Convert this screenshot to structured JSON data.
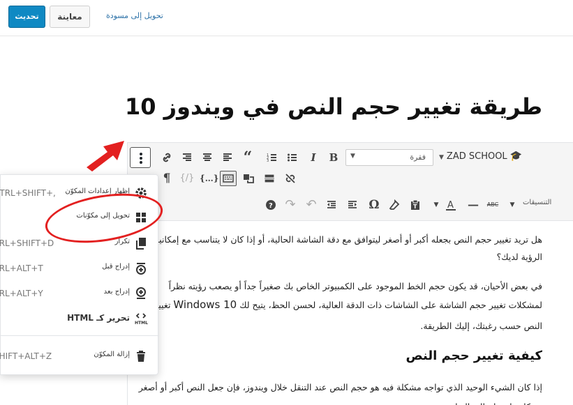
{
  "header": {
    "update_label": "تحديث",
    "preview_label": "معاينة",
    "switch_to_draft_label": "تحويل إلى مسودة"
  },
  "post": {
    "title": "طريقة تغيير حجم النص في ويندوز 10"
  },
  "toolbar": {
    "format_value": "فقرة",
    "brand_label": "ZAD SCHOOL",
    "styles_label": "التنسيقات"
  },
  "content": {
    "p1_line1": "هل تريد تغيير حجم النص بجعله أكبر أو أصغر ليتوافق مع دقة الشاشة الحالية، أو إذا كان لا يتناسب مع إمكانية",
    "p1_line2": "الرؤية لديك؟",
    "p2_line1": "في بعض الأحيان، قد يكون حجم الخط الموجود على الكمبيوتر الخاص بك صغيراً جداً أو يصعب رؤيته نظراً",
    "p2_line2_a": "لمشكلات تغيير حجم الشاشة على الشاشات ذات الدقة العالية، لحسن الحظ، يتيح لك ",
    "p2_line2_b": "Windows 10",
    "p2_line2_c": " تغيير حجم",
    "p2_line3": "النص حسب رغبتك، إليك الطريقة.",
    "heading": "كيفية تغيير حجم النص",
    "p3_line1": "إذا كان الشيء الوحيد الذي تواجه مشكلة فيه هو حجم النص عند التنقل خلال ويندوز، فإن جعل النص أكبر أو أصغر",
    "p3_line2": "هو كل ما تحتاج إلى القيام به."
  },
  "menu": {
    "items": [
      {
        "label": "إظهار إعدادات المكوّن",
        "shortcut": "CTRL+SHIFT+,"
      },
      {
        "label": "تحويل إلى مكوّنات",
        "shortcut": ""
      },
      {
        "label": "تكرار",
        "shortcut": "CTRL+SHIFT+D"
      },
      {
        "label": "إدراج قبل",
        "shortcut": "CTRL+ALT+T"
      },
      {
        "label": "إدراج بعد",
        "shortcut": "CTRL+ALT+Y"
      },
      {
        "label": "تحرير كـ HTML",
        "shortcut": ""
      },
      {
        "label": "إزالة المكوّن",
        "shortcut": "SHIFT+ALT+Z"
      }
    ]
  },
  "colors": {
    "accent": "#0f89c3",
    "annotation_red": "#e32020"
  }
}
